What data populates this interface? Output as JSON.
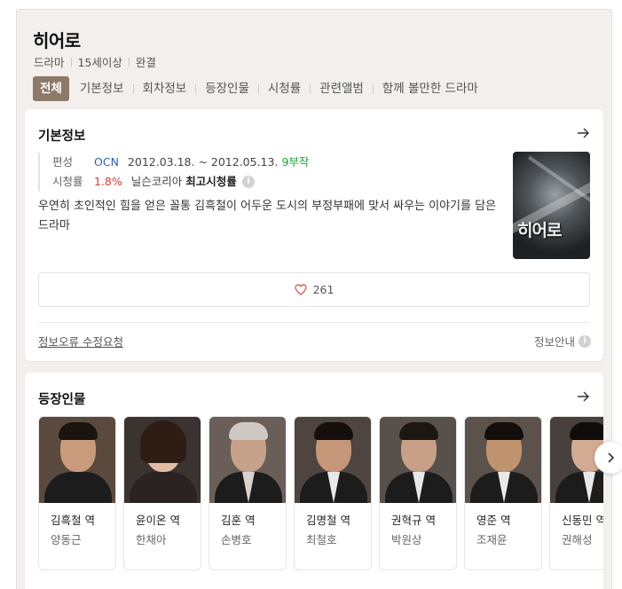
{
  "title": "히어로",
  "meta": [
    "드라마",
    "15세이상",
    "완결"
  ],
  "tabs": [
    "전체",
    "기본정보",
    "회차정보",
    "등장인물",
    "시청률",
    "관련앨범",
    "함께 볼만한 드라마"
  ],
  "basic_info": {
    "heading": "기본정보",
    "broadcast_label": "편성",
    "channel": "OCN",
    "dates": "2012.03.18. ~ 2012.05.13.",
    "episodes": "9부작",
    "rating_label": "시청률",
    "rating_value": "1.8%",
    "rating_source": "닐슨코리아",
    "rating_best": "최고시청률",
    "description": "우연히 초인적인 힘을 얻은 꼴통 김흑철이 어두운 도시의 부정부패에 맞서 싸우는 이야기를 담은 드라마",
    "poster_title": "히어로",
    "likes": "261",
    "report_link": "정보오류 수정요청",
    "info_guide": "정보안내"
  },
  "cast": {
    "heading": "등장인물",
    "people": [
      {
        "role": "김흑철 역",
        "actor": "양동근"
      },
      {
        "role": "윤이온 역",
        "actor": "한채아"
      },
      {
        "role": "김훈 역",
        "actor": "손병호"
      },
      {
        "role": "김명철 역",
        "actor": "최철호"
      },
      {
        "role": "권혁규 역",
        "actor": "박원상"
      },
      {
        "role": "영준 역",
        "actor": "조재윤"
      },
      {
        "role": "신동민 역",
        "actor": "권해성"
      }
    ]
  },
  "icons": {
    "arrow": "arrow-right-icon",
    "heart": "heart-icon",
    "info": "info-icon",
    "next": "chevron-right-icon"
  },
  "colors": {
    "active_tab": "#8d7967",
    "channel": "#2a63b8",
    "episodes": "#1aa53a",
    "rating": "#e03c31"
  }
}
